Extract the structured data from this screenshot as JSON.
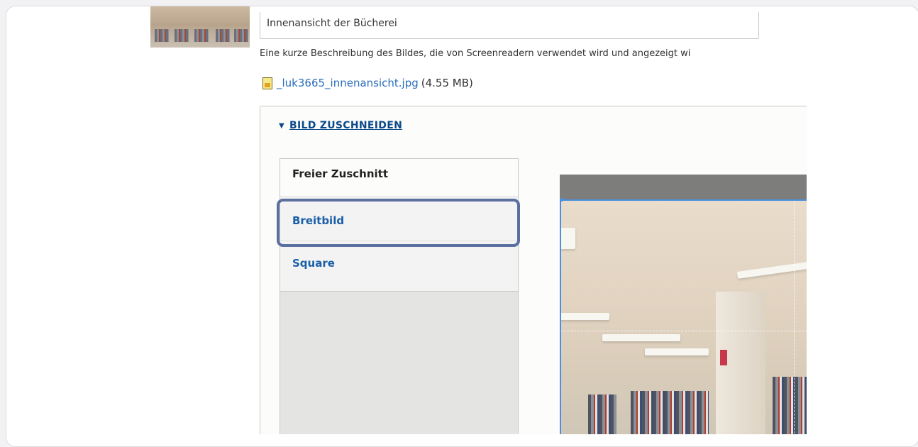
{
  "media": {
    "alt_text_value": "Innenansicht der Bücherei",
    "alt_text_description": "Eine kurze Beschreibung des Bildes, die von Screenreadern verwendet wird und angezeigt wi",
    "file_name": "_luk3665_innenansicht.jpg",
    "file_size": "(4.55 MB)"
  },
  "crop": {
    "summary_label": "BILD ZUSCHNEIDEN",
    "tabs": [
      {
        "label": "Freier Zuschnitt"
      },
      {
        "label": "Breitbild"
      },
      {
        "label": "Square"
      }
    ]
  },
  "colors": {
    "link": "#2a6ebb",
    "highlight": "#5b6fa0",
    "crop_frame": "#4a90e2"
  },
  "icons": [
    "image-file-icon",
    "triangle-down-icon"
  ]
}
